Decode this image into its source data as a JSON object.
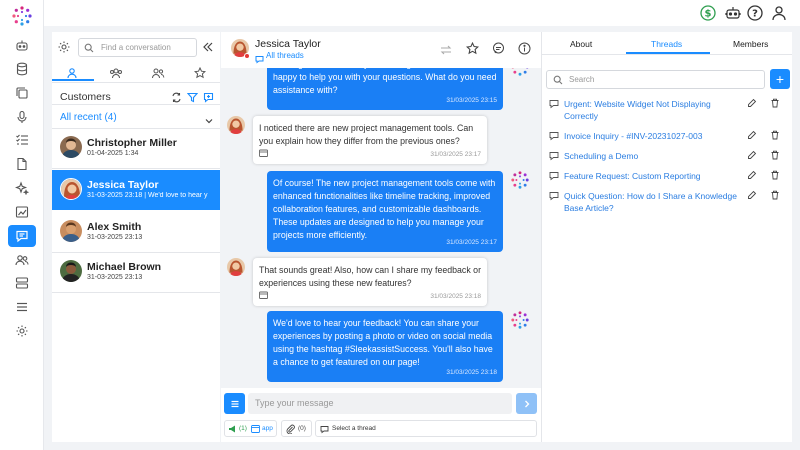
{
  "top_icons": [
    "dollar-icon",
    "robot-icon",
    "help-icon",
    "user-icon"
  ],
  "nav_icons": [
    "bot-nav-icon",
    "database-nav-icon",
    "copy-nav-icon",
    "mic-nav-icon",
    "checklist-nav-icon",
    "document-nav-icon",
    "sparkle-nav-icon",
    "chart-nav-icon",
    "chat-nav-icon",
    "users-nav-icon",
    "server-nav-icon",
    "menu-nav-icon",
    "settings-nav-icon"
  ],
  "left": {
    "search_placeholder": "Find a conversation",
    "section_title": "Customers",
    "filter_label": "All recent (4)",
    "conversations": [
      {
        "name": "Christopher Miller",
        "sub": "01-04-2025 1:34"
      },
      {
        "name": "Jessica Taylor",
        "sub": "31-03-2025 23:18 | We'd love to hear y"
      },
      {
        "name": "Alex Smith",
        "sub": "31-03-2025 23:13"
      },
      {
        "name": "Michael Brown",
        "sub": "31-03-2025 23:13"
      }
    ]
  },
  "chat": {
    "contact_name": "Jessica Taylor",
    "threads_link": "All threads",
    "messages": [
      {
        "direction": "out",
        "text": "We're glad to hear that you're using our service! I'd be happy to help you with your questions. What do you need assistance with?",
        "time": "31/03/2025 23:15"
      },
      {
        "direction": "in",
        "text": "I noticed there are new project management tools. Can you explain how they differ from the previous ones?",
        "time": "31/03/2025 23:17"
      },
      {
        "direction": "out",
        "text": "Of course! The new project management tools come with enhanced functionalities like timeline tracking, improved collaboration features, and customizable dashboards. These updates are designed to help you manage your projects more efficiently.",
        "time": "31/03/2025 23:17"
      },
      {
        "direction": "in",
        "text": "That sounds great! Also, how can I share my feedback or experiences using these new features?",
        "time": "31/03/2025 23:18"
      },
      {
        "direction": "out",
        "text": "We'd love to hear your feedback! You can share your experiences by posting a photo or video on social media using the hashtag #SleekassistSuccess. You'll also have a chance to get featured on our page!",
        "time": "31/03/2025 23:18"
      }
    ],
    "input_placeholder": "Type your message",
    "channel_count": "(1)",
    "channel_label": "app",
    "attachment_count": "(0)",
    "thread_select": "Select a thread"
  },
  "right": {
    "tabs": [
      "About",
      "Threads",
      "Members"
    ],
    "active_tab": "Threads",
    "search_placeholder": "Search",
    "add_label": "+",
    "threads": [
      "Urgent: Website Widget Not Displaying Correctly",
      "Invoice Inquiry - #INV-20231027-003",
      "Scheduling a Demo",
      "Feature Request: Custom Reporting",
      "Quick Question: How do I Share a Knowledge Base Article?"
    ]
  },
  "colors": {
    "accent": "#1a8cff",
    "bubble_out": "#1a7ff5",
    "link": "#2a7de1",
    "online": "#2e9e4f"
  }
}
